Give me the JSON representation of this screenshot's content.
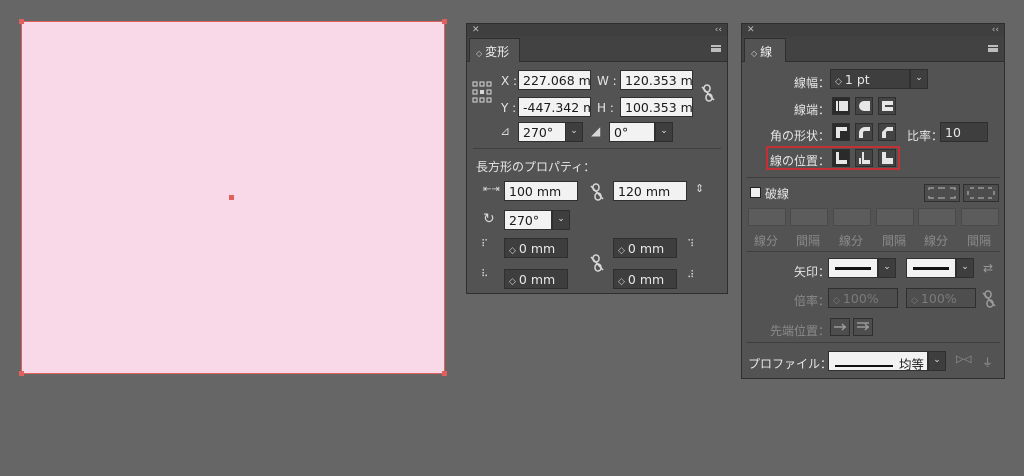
{
  "transform_panel": {
    "tab": "変形",
    "x_label": "X :",
    "x_value": "227.068 m",
    "y_label": "Y :",
    "y_value": "-447.342 m",
    "w_label": "W :",
    "w_value": "120.353 m",
    "h_label": "H :",
    "h_value": "100.353 m",
    "angle_value": "270°",
    "shear_value": "0°",
    "rect_props_title": "長方形のプロパティ：",
    "rect_width": "100 mm",
    "rect_height": "120 mm",
    "rect_rotation": "270°",
    "corner_tl": "0 mm",
    "corner_tr": "0 mm",
    "corner_bl": "0 mm",
    "corner_br": "0 mm"
  },
  "stroke_panel": {
    "tab": "線",
    "weight_label": "線幅：",
    "weight_value": "1 pt",
    "cap_label": "線端：",
    "corner_label": "角の形状：",
    "miter_label": "比率：",
    "miter_value": "10",
    "align_label": "線の位置：",
    "dashed_label": "破線",
    "dash_labels": [
      "線分",
      "間隔",
      "線分",
      "間隔",
      "線分",
      "間隔"
    ],
    "arrowhead_label": "矢印：",
    "scale_label": "倍率：",
    "scale_start": "100%",
    "scale_end": "100%",
    "align_arrow_label": "先端位置：",
    "profile_label": "プロファイル：",
    "profile_value": "均等"
  },
  "colors": {
    "selection": "#e0605e",
    "fill": "#f9d8e8",
    "highlight": "#c43034"
  }
}
